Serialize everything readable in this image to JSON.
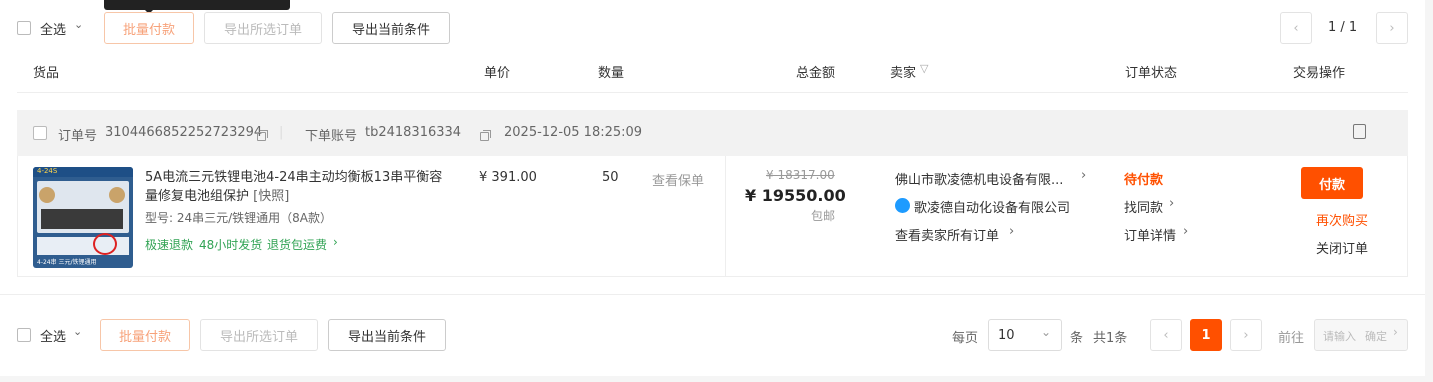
{
  "top_toolbar": {
    "select_all": "全选",
    "batch_pay": "批量付款",
    "export_selected": "导出所选订单",
    "export_current": "导出当前条件",
    "page_indicator": "1 / 1",
    "prev_icon": "chevron-left-icon",
    "next_icon": "chevron-right-icon"
  },
  "table_header": {
    "goods": "货品",
    "unit_price": "单价",
    "quantity": "数量",
    "total": "总金额",
    "seller": "卖家",
    "order_status": "订单状态",
    "actions": "交易操作"
  },
  "order": {
    "order_no_label": "订单号",
    "order_no": "3104466852252723294",
    "account_label": "下单账号",
    "account": "tb2418316334",
    "datetime": "2025-12-05 18:25:09",
    "item": {
      "title": "5A电流三元铁锂电池4-24串主动均衡板13串平衡容量修复电池组保护",
      "tag": "[快照]",
      "spec": "型号: 24串三元/铁锂通用（8A款）",
      "service_1": "极速退款",
      "service_2": "48小时发货",
      "service_3": "退货包运费",
      "price": "¥ 391.00",
      "qty": "50",
      "warranty": "查看保单",
      "thumb_text_top": "4-24S",
      "thumb_text_bottom": "4-24串 三元/铁锂通用"
    },
    "original_total": "¥ 18317.00",
    "total": "¥ 19550.00",
    "shipping": "包邮",
    "seller_name": "佛山市歌凌德机电设备有限...",
    "shop_name": "歌凌德自动化设备有限公司",
    "view_seller_orders": "查看卖家所有订单",
    "status": "待付款",
    "contract": "找同款",
    "order_detail": "订单详情",
    "pay": "付款",
    "rebuy": "再次购买",
    "close_order": "关闭订单"
  },
  "bottom_toolbar": {
    "select_all": "全选",
    "batch_pay": "批量付款",
    "export_selected": "导出所选订单",
    "export_current": "导出当前条件",
    "per_page_label": "每页",
    "per_page_value": "10",
    "items_label": "条",
    "total_count": "共1条",
    "current_page": "1",
    "goto_label": "前往",
    "goto_placeholder": "请输入",
    "confirm": "确定"
  },
  "colors": {
    "accent": "#ff5000",
    "status": "#ff5000",
    "service_green": "#31a354"
  }
}
